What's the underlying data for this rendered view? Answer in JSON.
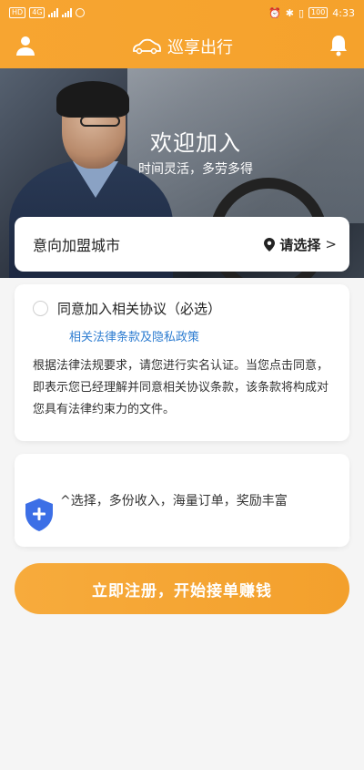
{
  "status_bar": {
    "left_chips": [
      "HD",
      "4G"
    ],
    "time": "4:33",
    "battery": "100"
  },
  "header": {
    "brand": "巡享出行",
    "user_icon": "user-icon",
    "bell_icon": "bell-icon"
  },
  "hero": {
    "title": "欢迎加入",
    "subtitle": "时间灵活，多劳多得"
  },
  "city": {
    "label": "意向加盟城市",
    "select_label": "请选择",
    "chevron": ">"
  },
  "agreement": {
    "title": "同意加入相关协议（必选）",
    "link": "相关法律条款及隐私政策",
    "description": "根据法律法规要求，请您进行实名认证。当您点击同意，即表示您已经理解并同意相关协议条款，该条款将构成对您具有法律约束力的文件。"
  },
  "feature": {
    "text": "^选择，多份收入，海量订单，奖励丰富"
  },
  "cta": {
    "label": "立即注册，开始接单赚钱"
  },
  "colors": {
    "accent": "#f5a22c",
    "link": "#2e7dd1",
    "shield": "#3c6fe6"
  }
}
